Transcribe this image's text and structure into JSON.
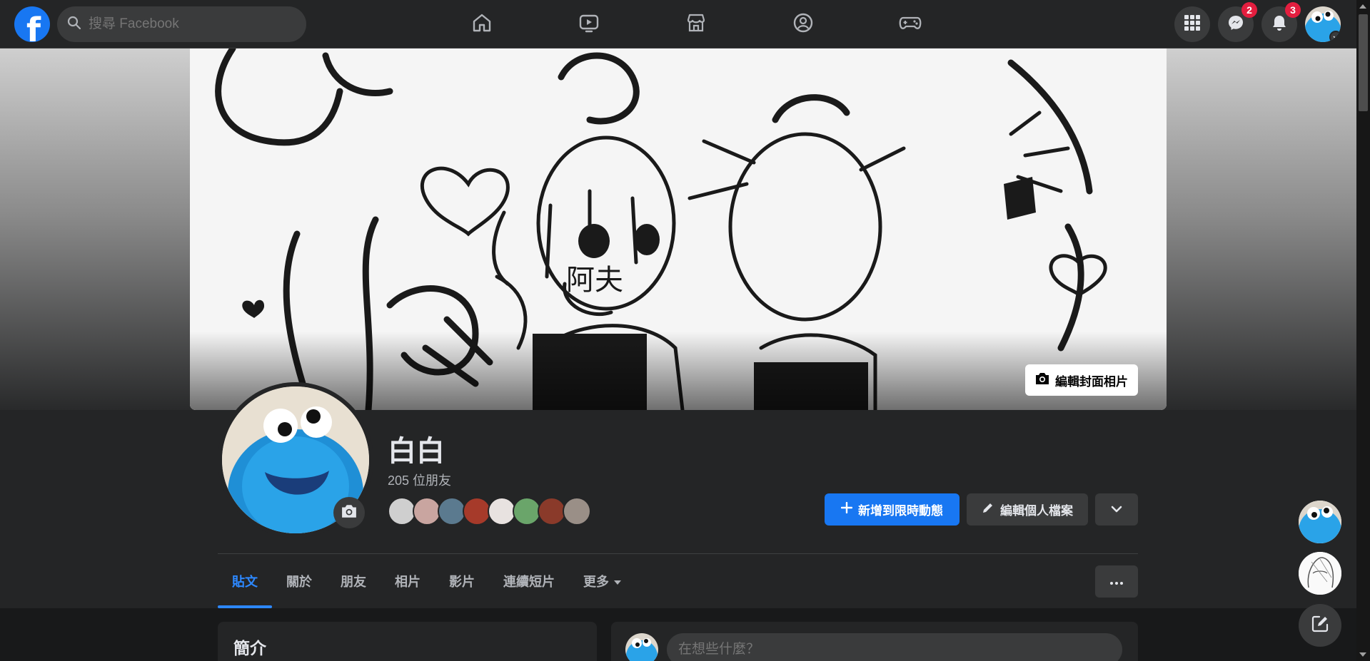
{
  "app": {
    "brand_color": "#1877f2"
  },
  "search": {
    "placeholder": "搜尋 Facebook"
  },
  "topnav": {
    "icons": [
      "home-icon",
      "watch-icon",
      "marketplace-icon",
      "groups-icon",
      "gaming-icon"
    ]
  },
  "account": {
    "menu_icon": "grid-menu-icon",
    "messenger_badge": "2",
    "notifications_badge": "3"
  },
  "cover": {
    "edit_cover_label": "編輯封面相片",
    "handwritten_text": "阿夫"
  },
  "profile": {
    "name": "白白",
    "friend_count": "205 位朋友",
    "friend_avatar_colors": [
      "#cfcfcf",
      "#c9a5a0",
      "#5b7a8f",
      "#a63a2a",
      "#e8e2e0",
      "#6aa56a",
      "#8a3a2a",
      "#9a8f87"
    ]
  },
  "actions": {
    "add_story_label": "新增到限時動態",
    "edit_profile_label": "編輯個人檔案"
  },
  "tabs": [
    {
      "label": "貼文",
      "active": true
    },
    {
      "label": "關於"
    },
    {
      "label": "朋友"
    },
    {
      "label": "相片"
    },
    {
      "label": "影片"
    },
    {
      "label": "連續短片"
    },
    {
      "label": "更多"
    }
  ],
  "intro": {
    "title": "簡介"
  },
  "composer": {
    "placeholder": "在想些什麼？"
  },
  "colors": {
    "accent": "#2d88ff",
    "badge": "#e41e3f",
    "surface": "#242526",
    "background": "#18191a"
  }
}
